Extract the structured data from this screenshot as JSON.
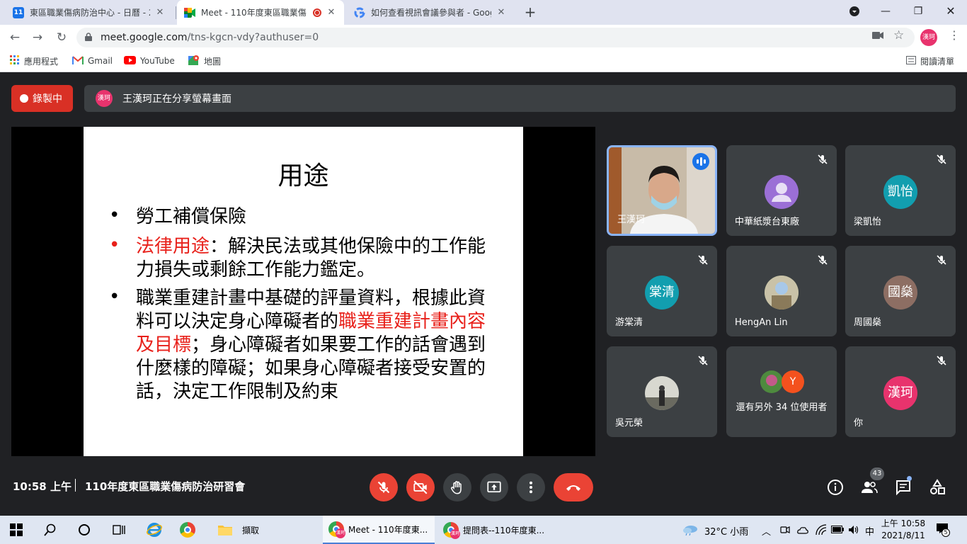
{
  "browser": {
    "tabs": [
      {
        "title": "東區職業傷病防治中心 - 日曆 - 2",
        "favicon": "calendar-icon",
        "favicon_text": "11",
        "active": false
      },
      {
        "title": "Meet - 110年度東區職業傷",
        "favicon": "meet-icon",
        "active": true,
        "recording": true
      },
      {
        "title": "如何查看視訊會議參與者 - Goog",
        "favicon": "google-icon",
        "active": false
      }
    ],
    "url_host": "meet.google.com",
    "url_path": "/tns-kgcn-vdy?authuser=0",
    "profile_initials": "漢珂",
    "bookmarks": [
      {
        "label": "應用程式",
        "icon": "apps-grid-icon"
      },
      {
        "label": "Gmail",
        "icon": "gmail-icon"
      },
      {
        "label": "YouTube",
        "icon": "youtube-icon"
      },
      {
        "label": "地圖",
        "icon": "maps-icon"
      }
    ],
    "reading_list": "閱讀清單"
  },
  "meet": {
    "recording_label": "錄製中",
    "presenter_initials": "漢珂",
    "share_banner": "王漢珂正在分享螢幕畫面",
    "slide": {
      "title": "用途",
      "bullet1": "勞工補償保險",
      "bullet2_red": "法律用途",
      "bullet2_rest": "：解決民法或其他保險中的工作能力損失或剩餘工作能力鑑定。",
      "bullet3_a": "職業重建計畫中基礎的評量資料，根據此資料可以決定身心障礙者的",
      "bullet3_red": "職業重建計畫內容及目標",
      "bullet3_b": "；身心障礙者如果要工作的話會遇到什麼樣的障礙；如果身心障礙者接受安置的話，決定工作限制及約束"
    },
    "participants": [
      {
        "name": "王漢珂",
        "type": "video",
        "speaking": true
      },
      {
        "name": "中華紙漿台東廠",
        "type": "avatar",
        "avatar_text": "",
        "color": "#9b6fd6",
        "muted": true
      },
      {
        "name": "梁凱怡",
        "type": "avatar",
        "avatar_text": "凱怡",
        "color": "#129eaf",
        "muted": true
      },
      {
        "name": "游棠清",
        "type": "avatar",
        "avatar_text": "棠清",
        "color": "#129eaf",
        "muted": true
      },
      {
        "name": "HengAn Lin",
        "type": "photo",
        "muted": true
      },
      {
        "name": "周國燊",
        "type": "avatar",
        "avatar_text": "國燊",
        "color": "#8d6e63",
        "muted": true
      },
      {
        "name": "吳元榮",
        "type": "photo",
        "muted": true
      },
      {
        "name": "還有另外 34 位使用者",
        "type": "group",
        "avatar_text": "Y"
      },
      {
        "name": "你",
        "type": "avatar",
        "avatar_text": "漢珂",
        "color": "#e8336d",
        "muted": true
      }
    ],
    "time": "10:58 上午",
    "meeting_name": "110年度東區職業傷病防治研習會",
    "people_count": "43"
  },
  "taskbar": {
    "apps": [
      {
        "label": "擷取",
        "icon": "folder-icon"
      },
      {
        "label": "Meet - 110年度東...",
        "icon": "chrome-icon",
        "active": true
      },
      {
        "label": "提問表--110年度東...",
        "icon": "chrome-icon",
        "active": false
      }
    ],
    "weather": "32°C  小雨",
    "ime": "中",
    "clock_time": "上午 10:58",
    "clock_date": "2021/8/11",
    "notification_count": "5"
  }
}
